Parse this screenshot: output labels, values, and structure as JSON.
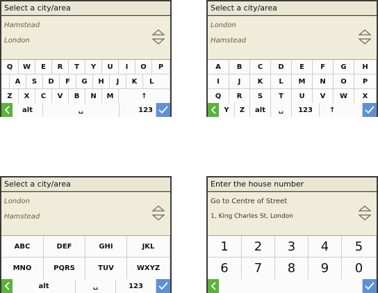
{
  "screens": [
    {
      "title": "Select a city/area",
      "suggestions": [
        "Hamstead",
        "London"
      ],
      "rows": [
        [
          "Q",
          "W",
          "E",
          "R",
          "T",
          "Y",
          "U",
          "I",
          "O",
          "P"
        ],
        [
          "A",
          "S",
          "D",
          "F",
          "G",
          "H",
          "J",
          "K",
          "L"
        ],
        [
          "Z",
          "X",
          "C",
          "V",
          "B",
          "N",
          "M",
          "↑"
        ]
      ],
      "bottom": {
        "alt": "alt",
        "space": "␣",
        "num": "123"
      }
    },
    {
      "title": "Select a city/area",
      "suggestions": [
        "London",
        "Hamstead"
      ],
      "rows": [
        [
          "A",
          "B",
          "C",
          "D",
          "E",
          "F",
          "G",
          "H"
        ],
        [
          "I",
          "J",
          "K",
          "L",
          "M",
          "N",
          "O",
          "P"
        ],
        [
          "Q",
          "R",
          "S",
          "T",
          "U",
          "V",
          "W",
          "X"
        ]
      ],
      "bottom": {
        "k1": "Y",
        "k2": "Z",
        "alt": "alt",
        "space": "␣",
        "num": "123",
        "shift": "↑"
      }
    },
    {
      "title": "Select a city/area",
      "suggestions": [
        "London",
        "Hamstead"
      ],
      "rows": [
        [
          "ABC",
          "DEF",
          "GHI",
          "JKL"
        ],
        [
          "MNO",
          "PQRS",
          "TUV",
          "WXYZ"
        ]
      ],
      "bottom": {
        "alt": "alt",
        "space": "␣",
        "num": "123"
      }
    },
    {
      "title": "Enter the house number",
      "suggestions": [
        "Go to Centre of Street",
        "1, King Charles St, London"
      ],
      "rows": [
        [
          "1",
          "2",
          "3",
          "4",
          "5"
        ],
        [
          "6",
          "7",
          "8",
          "9",
          "0"
        ]
      ],
      "bottom": {}
    }
  ],
  "colors": {
    "back": "#5bb33a",
    "ok": "#5f8fd7",
    "header": "#e9e6d3",
    "suggestion_text": "#6e5f3d"
  },
  "icons": {
    "back": "back-arrow-icon",
    "ok": "checkmark-icon",
    "scroll": "up-down-arrows-icon"
  }
}
